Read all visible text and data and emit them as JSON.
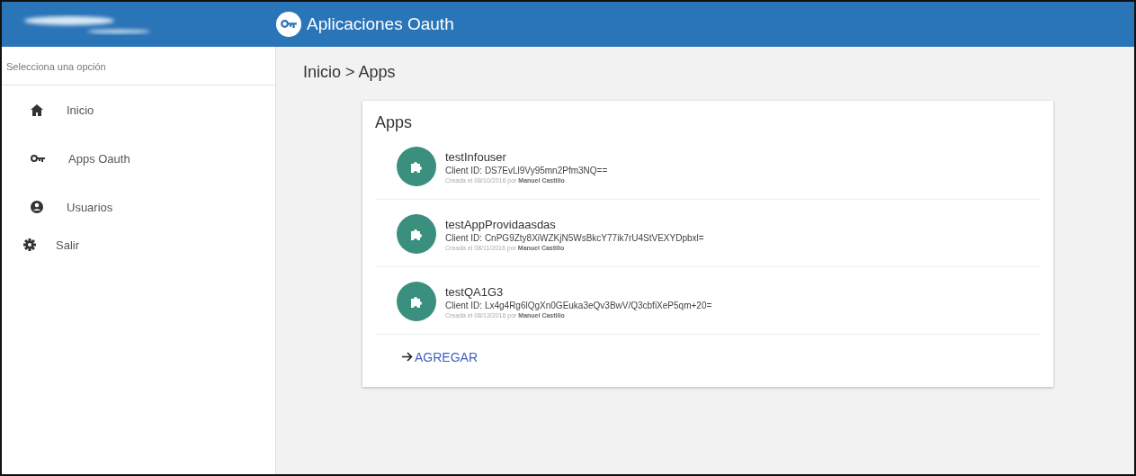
{
  "header": {
    "title": "Aplicaciones Oauth"
  },
  "sidebar": {
    "heading": "Selecciona una opción",
    "items": [
      {
        "label": "Inicio",
        "kind": "home"
      },
      {
        "label": "Apps Oauth",
        "kind": "key"
      },
      {
        "label": "Usuarios",
        "kind": "user"
      },
      {
        "label": "Salir",
        "kind": "gear"
      }
    ]
  },
  "breadcrumb": "Inicio > Apps",
  "card": {
    "title": "Apps",
    "apps": [
      {
        "name": "testInfouser",
        "client_id": "Client ID: DS7EvLl9Vy95mn2Pfm3NQ==",
        "created": "Creada el 08/10/2016 por **Manuel Castillo**"
      },
      {
        "name": "testAppProvidaasdas",
        "client_id": "Client ID: CnPG9Zty8XiWZKjN5WsBkcY77ik7rU4StVEXYDpbxl=",
        "created": "Creada el 08/11/2016 por **Manuel Castillo**"
      },
      {
        "name": "testQA1G3",
        "client_id": "Client ID: Lx4g4Rg6lQgXn0GEuka3eQv3BwV/Q3cbfiXeP5qm+20=",
        "created": "Creada el 08/13/2016 por **Manuel Castillo**"
      }
    ],
    "add_label": "AGREGAR"
  }
}
